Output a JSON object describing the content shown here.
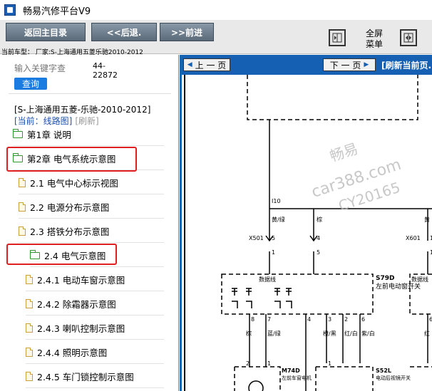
{
  "window": {
    "title": "畅易汽修平台V9"
  },
  "toolbar": {
    "home_label": "返回主目录",
    "back_label": "<<后退.",
    "forward_label": ">>前进",
    "fullscreen_label_1": "全屏",
    "fullscreen_label_2": "菜单",
    "current_car": "当前车型：  厂家:S-上海通用五菱乐驰2010-2012"
  },
  "search": {
    "placeholder": "输入关键字查",
    "code_line1": "44-",
    "code_line2": "22872",
    "query_label": "查询"
  },
  "breadcrumb": {
    "path": "[S-上海通用五菱-乐驰-2010-2012]",
    "current": "[当前：线路图]",
    "refresh": "[刷新]"
  },
  "tree": [
    {
      "label": "第1章 说明",
      "icon": "folder-icon"
    },
    {
      "label": "第2章 电气系统示意图",
      "icon": "folder-open-icon"
    },
    {
      "label": "2.1 电气中心标示视图",
      "icon": "document-icon"
    },
    {
      "label": "2.2 电源分布示意图",
      "icon": "document-icon"
    },
    {
      "label": "2.3 搭铁分布示意图",
      "icon": "document-icon"
    },
    {
      "label": "2.4 电气示意图",
      "icon": "folder-open-icon"
    },
    {
      "label": "2.4.1 电动车窗示意图",
      "icon": "document-icon"
    },
    {
      "label": "2.4.2 除霜器示意图",
      "icon": "document-icon"
    },
    {
      "label": "2.4.3 喇叭控制示意图",
      "icon": "document-icon"
    },
    {
      "label": "2.4.4 照明示意图",
      "icon": "document-icon"
    },
    {
      "label": "2.4.5 车门锁控制示意图",
      "icon": "document-icon"
    }
  ],
  "viewer": {
    "prev_label": "上 一 页",
    "next_label": "下 一 页",
    "refresh_label": "[刷新当前页."
  },
  "diagram": {
    "node_i10": "I10",
    "wire_yellow_green": "黄/绿",
    "wire_brown": "棕",
    "wire_yellow_right": "黄",
    "conn_x501": "X501",
    "conn_x601": "X601",
    "pin_5": "5",
    "pin_4": "4",
    "pin_5b": "5",
    "pin_1": "1",
    "pin_1b": "1",
    "pin_1c": "1",
    "data_line": "数据线",
    "data_line_right": "数据线",
    "s79d": "S79D",
    "s79d_desc": "左前电动窗开关",
    "pin_8": "8",
    "pin_7": "7",
    "pin_4b": "4",
    "pin_3": "3",
    "pin_2": "2",
    "pin_6": "6",
    "pin_6b": "6",
    "wire_brown2": "棕",
    "wire_blue_green": "蓝/绿",
    "wire_orange_black": "橙/黑",
    "wire_red_white": "红/白",
    "wire_purple_white": "紫/白",
    "wire_red_right": "红",
    "pin_2b": "2",
    "pin_1d": "1",
    "pin_1e": "1",
    "m74d": "M74D",
    "m74d_desc": "左前车窗电机",
    "s52l": "S52L",
    "s52l_desc": "电动后视镜开关",
    "watermark_1": "畅易",
    "watermark_2": "car388.com",
    "watermark_3": "CY20165"
  }
}
